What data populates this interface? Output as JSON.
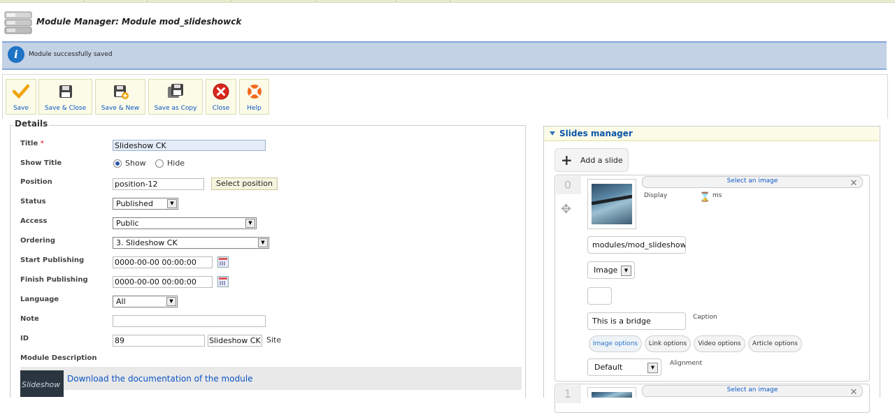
{
  "header": {
    "title": "Module Manager: Module mod_slideshowck"
  },
  "message": {
    "text": "Module successfully saved"
  },
  "toolbar": {
    "save": "Save",
    "save_close": "Save & Close",
    "save_new": "Save & New",
    "save_copy": "Save as Copy",
    "close": "Close",
    "help": "Help"
  },
  "details": {
    "legend": "Details",
    "title_label": "Title",
    "title_required": "*",
    "title_value": "Slideshow CK",
    "show_title_label": "Show Title",
    "show_option": "Show",
    "hide_option": "Hide",
    "position_label": "Position",
    "position_value": "position-12",
    "select_position": "Select position",
    "status_label": "Status",
    "status_value": "Published",
    "access_label": "Access",
    "access_value": "Public",
    "ordering_label": "Ordering",
    "ordering_value": "3. Slideshow CK",
    "start_label": "Start Publishing",
    "start_value": "0000-00-00 00:00:00",
    "finish_label": "Finish Publishing",
    "finish_value": "0000-00-00 00:00:00",
    "language_label": "Language",
    "language_value": "All",
    "note_label": "Note",
    "note_value": "",
    "id_label": "ID",
    "id_value": "89",
    "id_name": "Slideshow CK",
    "id_site": "Site",
    "module_description_label": "Module Description",
    "logo_text": "Slideshow",
    "doc_link": "Download the documentation of the module"
  },
  "slides": {
    "title": "Slides manager",
    "add_slide": "Add a slide",
    "items": [
      {
        "number": "0",
        "select_image": "Select an image",
        "display_label": "Display",
        "ms_label": "ms",
        "image_path": "modules/mod_slideshowck/",
        "type_value": "Image",
        "caption_value": "This is a bridge",
        "caption_label": "Caption",
        "tabs": [
          "Image options",
          "Link options",
          "Video options",
          "Article options"
        ],
        "alignment_value": "Default",
        "alignment_label": "Alignment"
      },
      {
        "number": "1",
        "select_image": "Select an image"
      }
    ]
  }
}
